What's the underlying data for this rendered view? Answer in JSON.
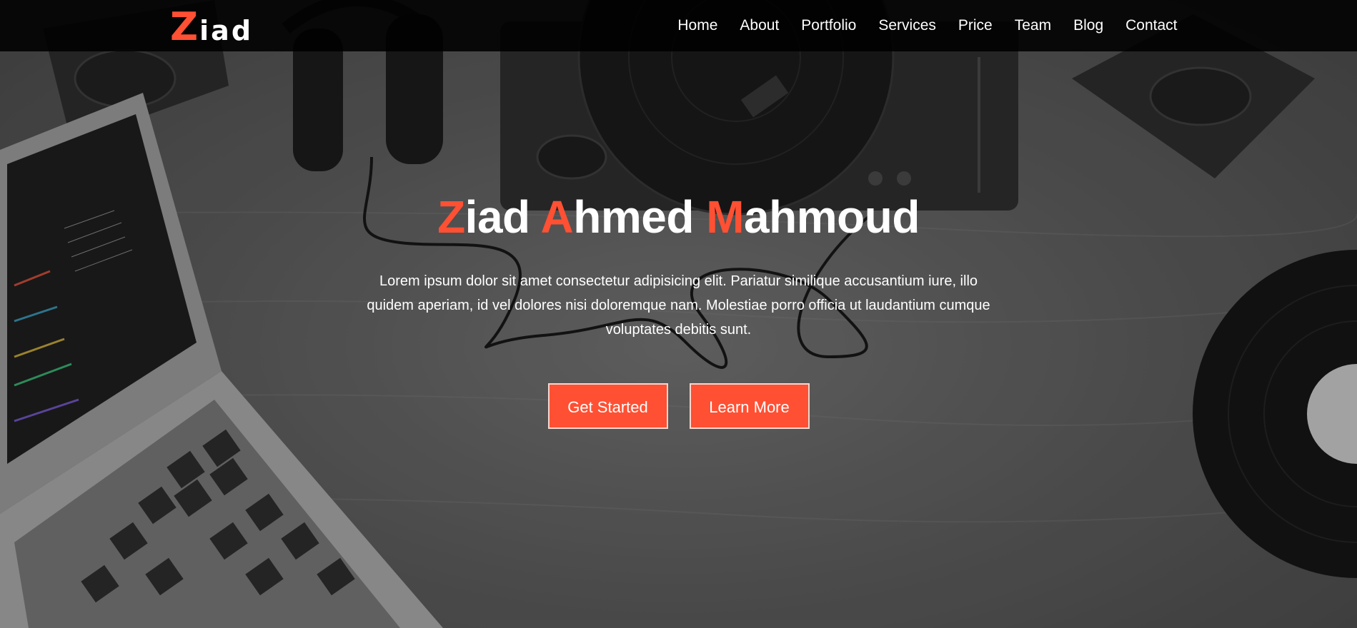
{
  "colors": {
    "accent": "#ff5033",
    "navbar_bg": "rgba(0,0,0,0.88)"
  },
  "logo": {
    "first": "Z",
    "rest": "iad"
  },
  "nav": {
    "items": [
      "Home",
      "About",
      "Portfolio",
      "Services",
      "Price",
      "Team",
      "Blog",
      "Contact"
    ]
  },
  "hero": {
    "title": {
      "w1_first": "Z",
      "w1_rest": "iad",
      "w2_first": "A",
      "w2_rest": "hmed",
      "w3_first": "M",
      "w3_rest": "ahmoud"
    },
    "text": "Lorem ipsum dolor sit amet consectetur adipisicing elit. Pariatur similique accusantium iure, illo quidem aperiam, id vel dolores nisi doloremque nam. Molestiae porro officia ut laudantium cumque voluptates debitis sunt.",
    "buttons": {
      "primary": "Get Started",
      "secondary": "Learn More"
    }
  },
  "background_objects": [
    "laptop",
    "headphones",
    "turntable",
    "speaker",
    "vinyl-record"
  ]
}
